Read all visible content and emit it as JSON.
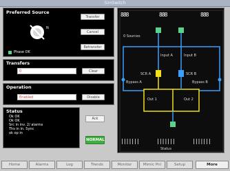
{
  "window": {
    "title": "SimSwitch"
  },
  "preferred_source": {
    "title": "Preferred Source",
    "symbol": "N",
    "buttons": [
      "Transfer",
      "Cancel",
      "Retransfer"
    ],
    "status": "Phase OK"
  },
  "transfers": {
    "title": "Transfers",
    "value": "0",
    "button": "Clear"
  },
  "operation": {
    "title": "Operation",
    "value": "Enabled",
    "button": "Disable"
  },
  "status_panel": {
    "title": "Status",
    "lines": [
      "Ok OK",
      "Ok OK",
      "Src in inv. 2/ alarms",
      "Ths in in. Sync",
      "ok op in"
    ],
    "ack_button": "Ack",
    "normal_button": "NORMAL"
  },
  "diagram": {
    "bypass_left_label": "Bypass A",
    "bypass_right_label": "Bypass B",
    "input_a": "Input A",
    "input_b": "Input B",
    "scr_a": "SCR A",
    "scr_b": "SCR B",
    "out_1": "Out 1",
    "out_2": "Out 2",
    "source_left": "0 Sources",
    "status_label": "Status",
    "top_readout_left": "888",
    "top_readout_mid": "888",
    "top_readout_right": "888",
    "bar_groups": [
      "|||||||",
      "|||||||",
      "|||||||"
    ]
  },
  "nav": [
    "Home",
    "Alarms",
    "Log",
    "Trends",
    "Monitor",
    "Mimic Pnl",
    "Setup",
    "More"
  ],
  "colors": {
    "bypass": "#3aa0ff",
    "output": "#f2e11a",
    "node": "#59d38b"
  }
}
